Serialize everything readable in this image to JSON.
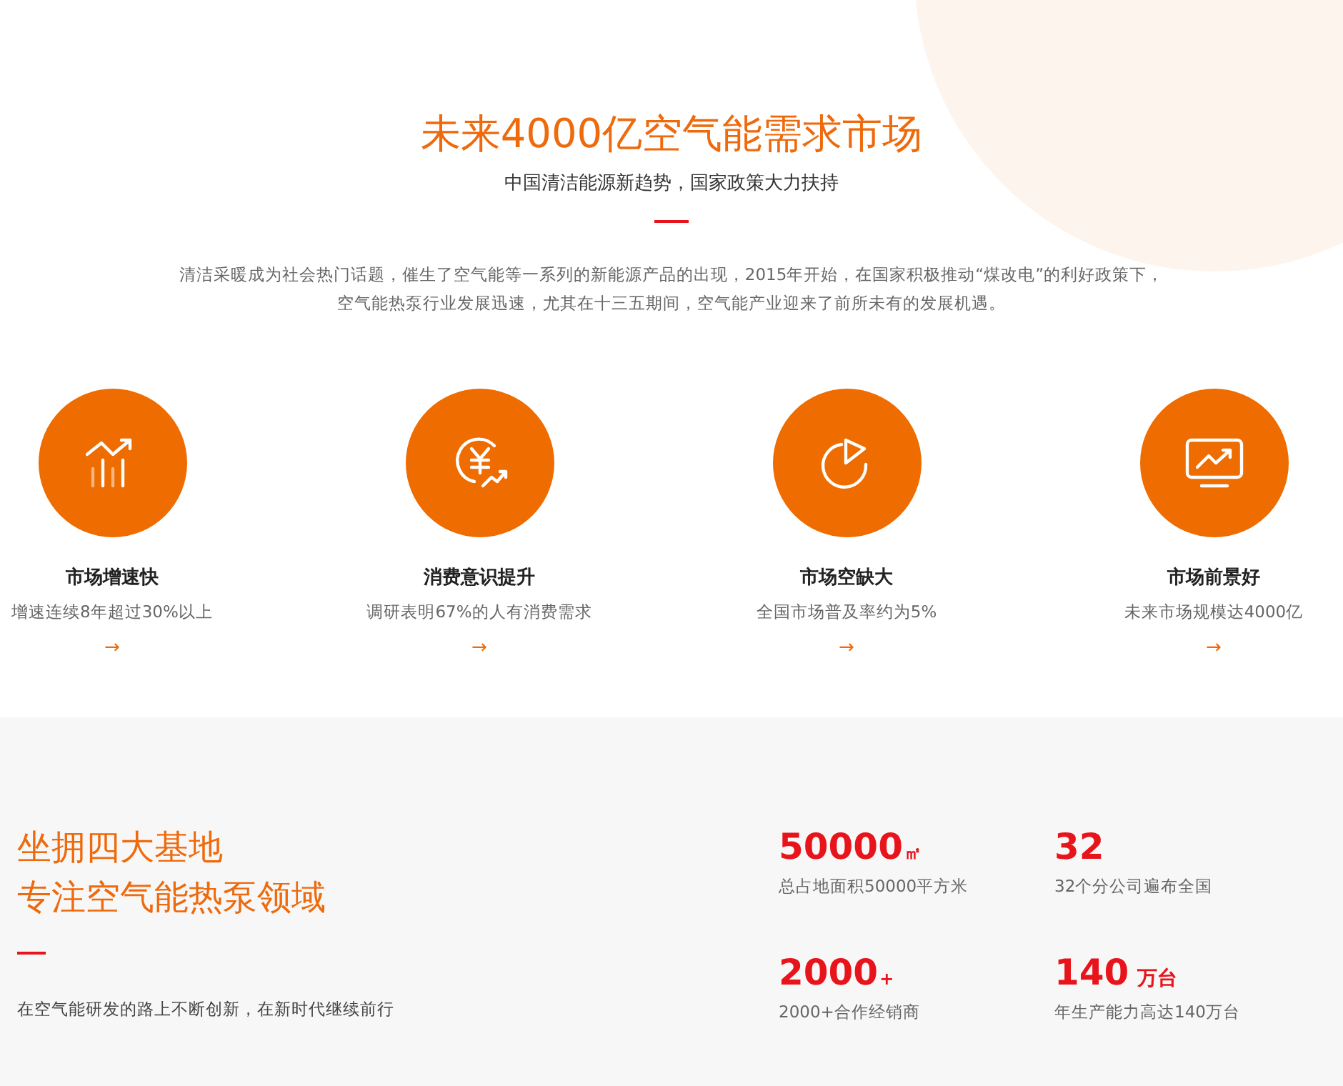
{
  "header": {
    "title": "未来4000亿空气能需求市场",
    "subtitle": "中国清洁能源新趋势，国家政策大力扶持",
    "intro": [
      "清洁采暖成为社会热门话题，催生了空气能等一系列的新能源产品的出现，2015年开始，在国家积极推动“煤改电”的利好政策下，",
      "空气能热泵行业发展迅速，尤其在十三五期间，空气能产业迎来了前所未有的发展机遇。"
    ]
  },
  "features": [
    {
      "kind": "growth",
      "title": "市场增速快",
      "text": "增速连续8年超过30%以上",
      "arrow": "→"
    },
    {
      "kind": "money",
      "title": "消费意识提升",
      "text": "调研表明67%的人有消费需求",
      "arrow": "→"
    },
    {
      "kind": "pie",
      "title": "市场空缺大",
      "text": "全国市场普及率约为5%",
      "arrow": "→"
    },
    {
      "kind": "monitor",
      "title": "市场前景好",
      "text": "未来市场规模达4000亿",
      "arrow": "→"
    }
  ],
  "bases": {
    "heading": [
      "坐拥四大基地",
      "专注空气能热泵领域"
    ],
    "text": "在空气能研发的路上不断创新，在新时代继续前行",
    "stats": [
      {
        "kind": "small",
        "value": "50000",
        "unit": "㎡",
        "label": "总占地面积50000平方米"
      },
      {
        "kind": "plain",
        "value": "32",
        "label": "32个分公司遍布全国"
      },
      {
        "kind": "small",
        "value": "2000",
        "unit": "+",
        "label": "2000+合作经销商"
      },
      {
        "kind": "word",
        "value": "140",
        "unit": "万台",
        "label": "年生产能力高达140万台"
      }
    ]
  }
}
